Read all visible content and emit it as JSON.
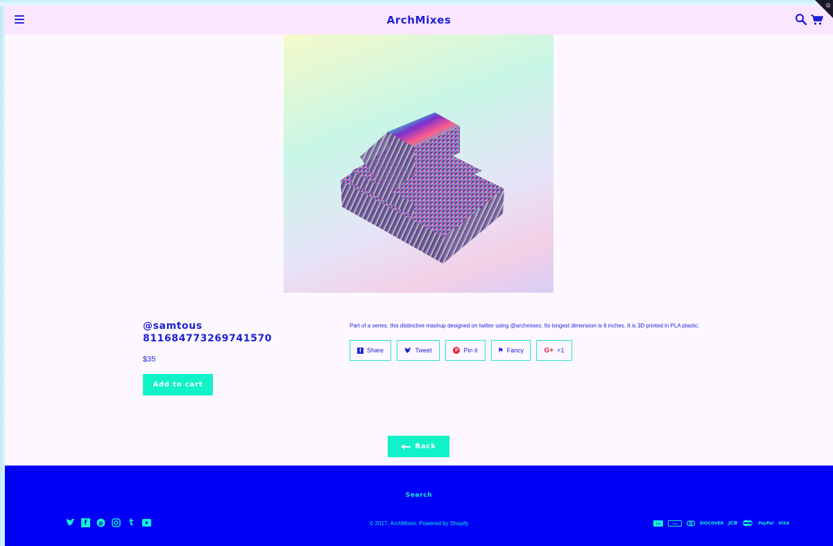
{
  "header": {
    "menu_icon": "hamburger-menu-icon",
    "title": "ArchMixes",
    "search_icon": "search-icon",
    "cart_icon": "cart-icon"
  },
  "product": {
    "title_line1": "@samtous",
    "title_line2": "811684773269741570",
    "price": "$35",
    "add_to_cart_label": "Add to cart",
    "description": "Part of a series, this distinctive mashup designed on twitter using @archmixes. Its longest dimension is 6 inches. It is 3D printed in PLA plastic.",
    "share_buttons": [
      {
        "label": "Share",
        "icon": "facebook-icon",
        "glyph": "f",
        "color": "#2022d8"
      },
      {
        "label": "Tweet",
        "icon": "twitter-icon",
        "glyph": "🐦",
        "color": "#2022d8"
      },
      {
        "label": "Pin it",
        "icon": "pinterest-icon",
        "glyph": "P",
        "color": "#e0243a"
      },
      {
        "label": "Fancy",
        "icon": "fancy-icon",
        "glyph": "⚑",
        "color": "#2022d8"
      },
      {
        "label": "+1",
        "icon": "google-plus-icon",
        "glyph": "G+",
        "color": "#e0243a"
      }
    ]
  },
  "back_label": "Back",
  "footer": {
    "search_label": "Search",
    "copyright": "© 2017, ArchMixes. Powered by Shopify",
    "social_icons": [
      "twitter-icon",
      "facebook-icon",
      "pinterest-icon",
      "instagram-icon",
      "tumblr-icon",
      "youtube-icon"
    ],
    "payment_icons": [
      "american-express",
      "apple-pay",
      "diners-club",
      "DISCOVER",
      "JCB",
      "master",
      "PayPal",
      "VISA"
    ]
  },
  "colors": {
    "brand_blue": "#1e20d6",
    "accent_teal": "#12f2c8",
    "header_bg": "#fbe6ff",
    "footer_bg": "#0000f7"
  }
}
